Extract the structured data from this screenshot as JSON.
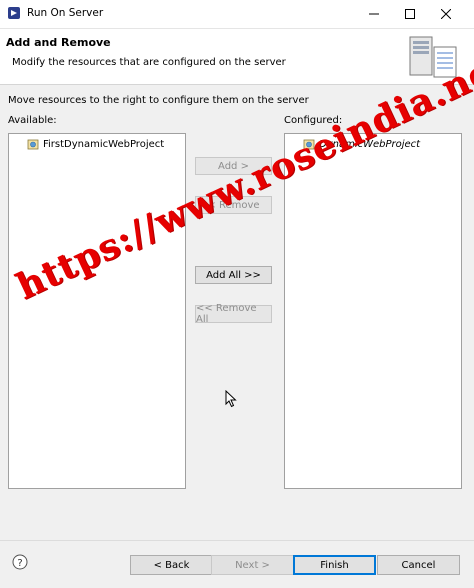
{
  "window": {
    "title": "Run On Server",
    "controls": [
      "minimize-icon",
      "maximize-icon",
      "close-icon"
    ]
  },
  "header": {
    "title": "Add and Remove",
    "description": "Modify the resources that are configured on the server",
    "image_icon": "server-wizard-icon"
  },
  "main": {
    "description": "Move resources to the right to configure them on the server",
    "available_label": "Available:",
    "configured_label": "Configured:",
    "available_items": [
      {
        "label": "FirstDynamicWebProject",
        "icon": "web-project-icon"
      }
    ],
    "configured_items": [
      {
        "label": "DynamicWebProject",
        "icon": "web-project-icon"
      }
    ],
    "buttons": {
      "add": "Add >",
      "remove": "< Remove",
      "add_all": "Add All >>",
      "remove_all": "<< Remove All"
    }
  },
  "footer": {
    "help_icon": "help-icon",
    "back": "< Back",
    "next": "Next >",
    "finish": "Finish",
    "cancel": "Cancel"
  },
  "watermark": "https://www.roseindia.net",
  "colors": {
    "watermark": "#e60000",
    "default_button_border": "#0078d7"
  }
}
